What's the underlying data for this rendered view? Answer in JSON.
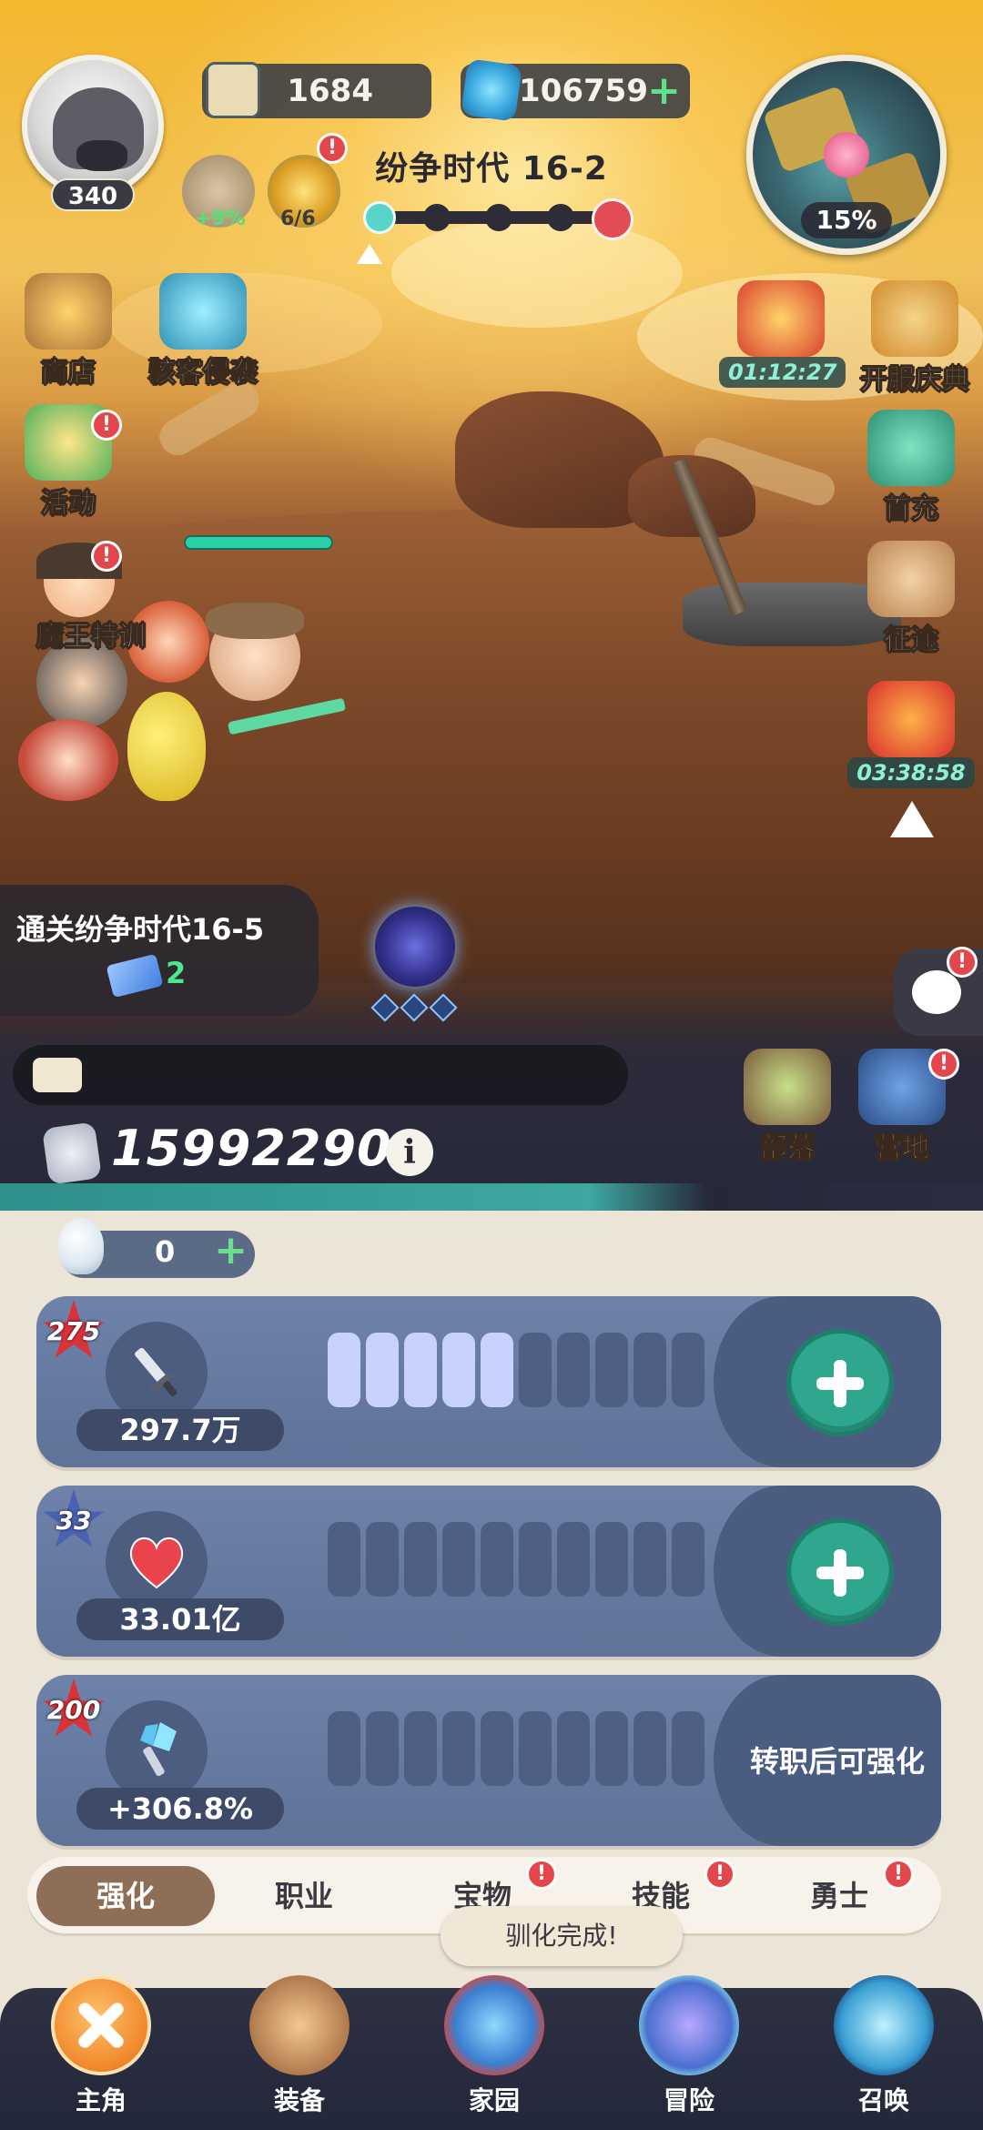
{
  "player": {
    "level": "340"
  },
  "resources": {
    "scroll_value": "1684",
    "gem_value": "106759",
    "gem_plus": "+"
  },
  "minimap": {
    "progress_label": "15%"
  },
  "buffs": {
    "owl_bonus": "+9%",
    "compass_count": "6/6"
  },
  "stage": {
    "title": "纷争时代 16-2"
  },
  "left_menu": {
    "shop": "商店",
    "invasion": "骇客侵袭",
    "events": "活动",
    "demon_training": "魔王特训"
  },
  "right_menu": {
    "timer_top": "01:12:27",
    "celebration": "开服庆典",
    "first_charge": "首充",
    "expedition": "征途",
    "timer_gift": "03:38:58"
  },
  "quest": {
    "text": "通关纷争时代16-5",
    "reward_count": "2"
  },
  "base_buttons": {
    "tribe": "部落",
    "camp": "营地"
  },
  "combat_power": {
    "value": "15992290",
    "info": "i"
  },
  "bulb": {
    "value": "0",
    "plus": "+"
  },
  "upgrades": [
    {
      "level": "275",
      "stat_value": "297.7万",
      "filled": 5,
      "total": 10
    },
    {
      "level": "33",
      "stat_value": "33.01亿",
      "filled": 0,
      "total": 10
    },
    {
      "level": "200",
      "stat_value": "+306.8%",
      "filled": 0,
      "total": 10,
      "locked_text": "转职后可强化"
    }
  ],
  "tabs": [
    "强化",
    "职业",
    "宝物",
    "技能",
    "勇士"
  ],
  "toast": "驯化完成!",
  "nav": [
    "主角",
    "装备",
    "家园",
    "冒险",
    "召唤"
  ],
  "colors": {
    "accent_teal": "#2fa78e",
    "badge_red": "#e4474b",
    "card_blue": "#6e82aa",
    "tab_active": "#8f6e57"
  },
  "icons": [
    "scroll-icon",
    "gem-icon",
    "owl-icon",
    "compass-icon",
    "sword-icon",
    "heart-icon",
    "crystal-sword-icon",
    "bulb-icon",
    "fist-icon",
    "info-icon",
    "chat-icon",
    "close-icon"
  ]
}
